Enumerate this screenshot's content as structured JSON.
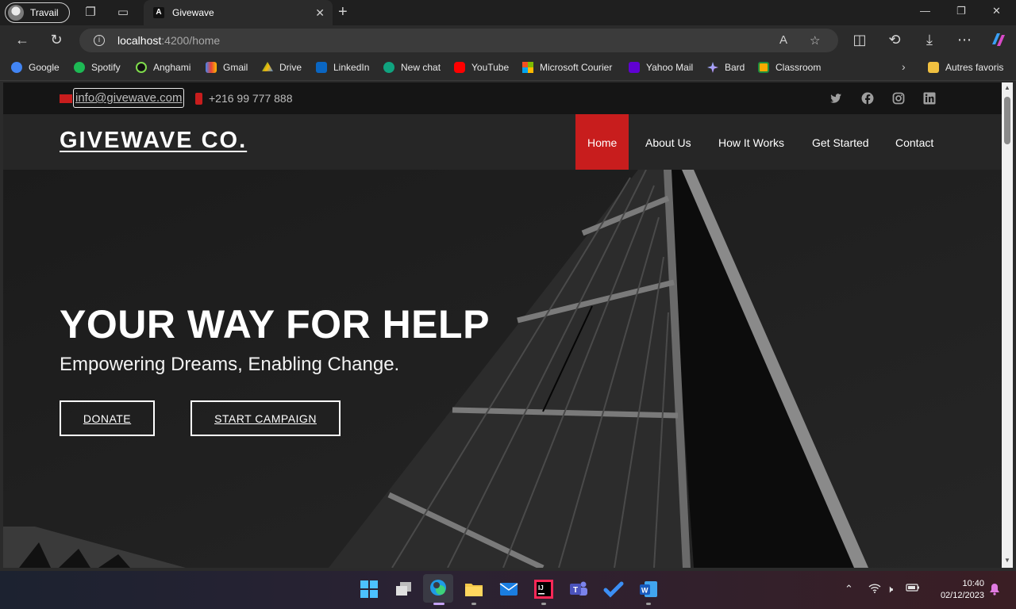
{
  "browser": {
    "profile_label": "Travail",
    "tab_title": "Givewave",
    "tab_favicon": "A",
    "url_host": "localhost",
    "url_path": ":4200/home",
    "bookmarks": [
      {
        "label": "Google",
        "icon": "google-icon",
        "color": "#4285f4"
      },
      {
        "label": "Spotify",
        "icon": "spotify-icon",
        "color": "#1db954"
      },
      {
        "label": "Anghami",
        "icon": "anghami-icon",
        "color": "#6b2bd9"
      },
      {
        "label": "Gmail",
        "icon": "gmail-icon",
        "color": "#ea4335"
      },
      {
        "label": "Drive",
        "icon": "drive-icon",
        "color": "#fbbc04"
      },
      {
        "label": "LinkedIn",
        "icon": "linkedin-icon",
        "color": "#0a66c2"
      },
      {
        "label": "New chat",
        "icon": "chatgpt-icon",
        "color": "#10a37f"
      },
      {
        "label": "YouTube",
        "icon": "youtube-icon",
        "color": "#ff0000"
      },
      {
        "label": "Microsoft Courier",
        "icon": "microsoft-icon",
        "color": "#f25022"
      },
      {
        "label": "Yahoo Mail",
        "icon": "yahoo-mail-icon",
        "color": "#6001d2"
      },
      {
        "label": "Bard",
        "icon": "bard-icon",
        "color": "#8ab4f8"
      },
      {
        "label": "Classroom",
        "icon": "classroom-icon",
        "color": "#f9ab00"
      }
    ],
    "other_favorites": "Autres favoris"
  },
  "site": {
    "email": "info@givewave.com",
    "phone": "+216 99 777 888",
    "social": [
      "twitter-icon",
      "facebook-icon",
      "instagram-icon",
      "linkedin-icon"
    ],
    "logo": "GIVEWAVE CO.",
    "nav": [
      {
        "label": "Home",
        "active": true
      },
      {
        "label": "About Us"
      },
      {
        "label": "How It Works"
      },
      {
        "label": "Get Started"
      },
      {
        "label": "Contact"
      }
    ],
    "hero": {
      "title": "YOUR WAY FOR HELP",
      "subtitle": "Empowering Dreams, Enabling Change.",
      "donate_label": "DONATE",
      "campaign_label": "START CAMPAIGN"
    },
    "accent_color": "#c81d1d"
  },
  "taskbar": {
    "time": "10:40",
    "date": "02/12/2023"
  }
}
